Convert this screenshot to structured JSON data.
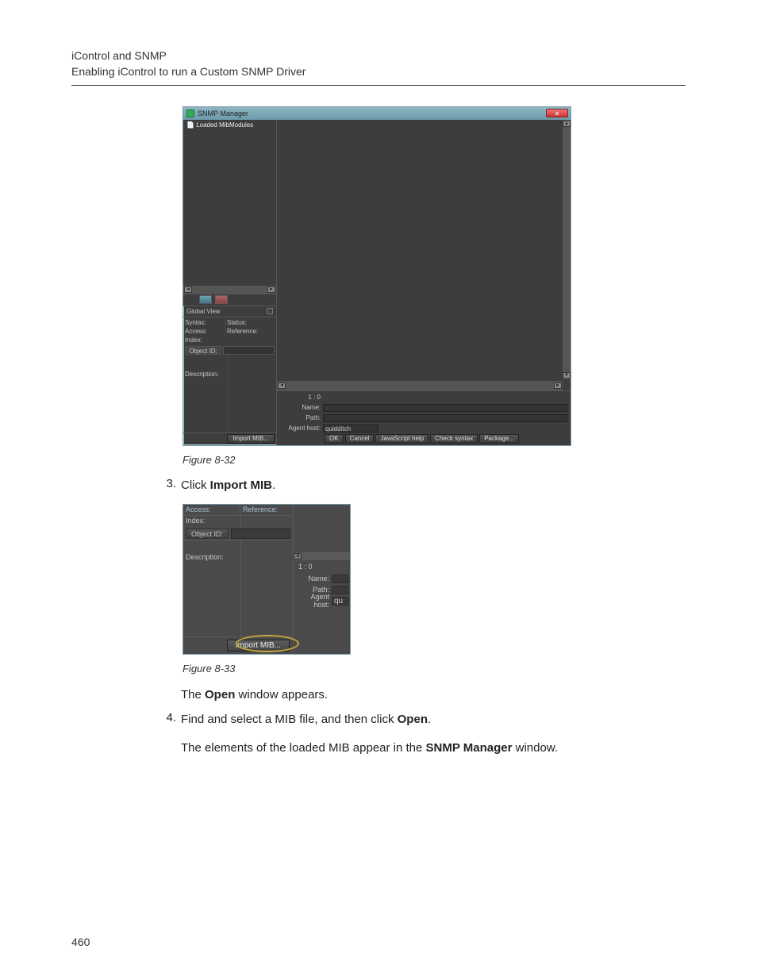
{
  "header": {
    "line1": "iControl and SNMP",
    "line2": "Enabling iControl to run a Custom SNMP Driver"
  },
  "fig1": {
    "title": "SNMP Manager",
    "close_glyph": "✕",
    "tree_root": "Loaded MibModules",
    "global_view": "Global View",
    "props": {
      "syntax_l": "Syntax:",
      "status_l": "Status:",
      "access_l": "Access:",
      "reference_l": "Reference:",
      "index_l": "Index:",
      "objectid_btn": "Object ID:",
      "description_l": "Description:"
    },
    "import_btn": "Import MIB...",
    "bottom": {
      "one_zero": "1 : 0",
      "name_l": "Name:",
      "path_l": "Path:",
      "agenthost_l": "Agent host:",
      "agenthost_v": "quidditch"
    },
    "buttons": {
      "ok": "OK",
      "cancel": "Cancel",
      "jshelp": "JavaScript help",
      "chksyntax": "Check syntax",
      "package": "Package..."
    },
    "caption": "Figure 8-32"
  },
  "step3": {
    "num": "3.",
    "prefix": "Click ",
    "bold": "Import MIB",
    "suffix": "."
  },
  "fig2": {
    "top_left": "Access:",
    "top_right": "Reference:",
    "index_l": "Index:",
    "objectid_btn": "Object ID:",
    "description_l": "Description:",
    "import_btn": "Import MIB...",
    "one_zero": "1 : 0",
    "name_l": "Name:",
    "path_l": "Path:",
    "agenthost_l": "Agent host:",
    "agenthost_v": "qu",
    "caption": "Figure 8-33"
  },
  "post2": {
    "pre": "The ",
    "b": "Open",
    "post": " window appears."
  },
  "step4": {
    "num": "4.",
    "pre": "Find and select a MIB file, and then click ",
    "b": "Open",
    "post": "."
  },
  "post4": {
    "pre": "The elements of the loaded MIB appear in the ",
    "b": "SNMP Manager",
    "post": " window."
  },
  "page_number": "460"
}
